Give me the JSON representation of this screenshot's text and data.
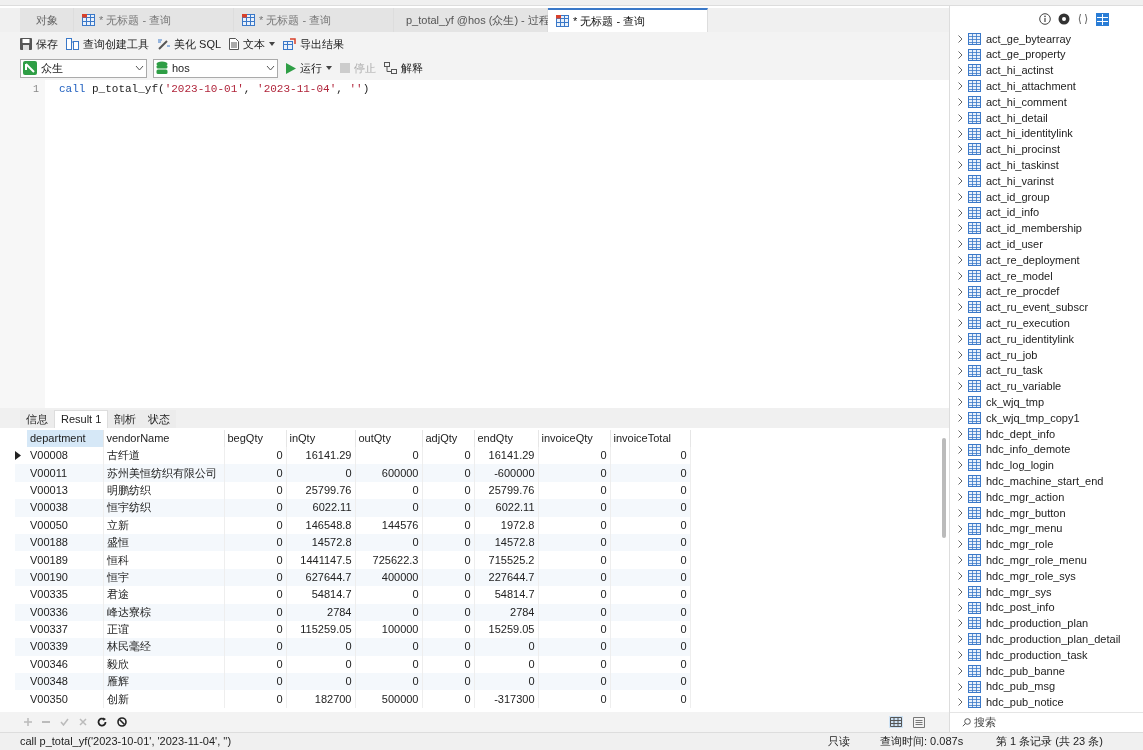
{
  "tabs": [
    {
      "label": "对象",
      "kind": "objects",
      "selected": false
    },
    {
      "label": "* 无标题 - 查询",
      "kind": "query",
      "selected": false
    },
    {
      "label": "* 无标题 - 查询",
      "kind": "query",
      "selected": false
    },
    {
      "label": "p_total_yf @hos (众生) - 过程",
      "kind": "procedure",
      "selected": false
    },
    {
      "label": "* 无标题 - 查询",
      "kind": "query",
      "selected": true
    }
  ],
  "toolbar": [
    {
      "label": "保存",
      "kind": "save"
    },
    {
      "label": "查询创建工具",
      "kind": "builder"
    },
    {
      "label": "美化 SQL",
      "kind": "beautify"
    },
    {
      "label": "文本",
      "kind": "text",
      "dropdown": true
    },
    {
      "label": "导出结果",
      "kind": "export"
    }
  ],
  "connection": "众生",
  "database": "hos",
  "actions": [
    {
      "label": "运行",
      "kind": "run",
      "disabled": false,
      "dropdown": true
    },
    {
      "label": "停止",
      "kind": "stop",
      "disabled": true
    },
    {
      "label": "解释",
      "kind": "explain",
      "disabled": false
    }
  ],
  "editor": {
    "line_number": "1",
    "tokens": [
      {
        "kind": "keyword",
        "text": "call"
      },
      {
        "kind": "plain",
        "text": " p_total_yf("
      },
      {
        "kind": "string",
        "text": "'2023-10-01'"
      },
      {
        "kind": "plain",
        "text": ", "
      },
      {
        "kind": "string",
        "text": "'2023-11-04'"
      },
      {
        "kind": "plain",
        "text": ", "
      },
      {
        "kind": "string",
        "text": "''"
      },
      {
        "kind": "plain",
        "text": ")"
      }
    ]
  },
  "result_tabs": [
    {
      "label": "信息",
      "selected": false
    },
    {
      "label": "Result 1",
      "selected": true
    },
    {
      "label": "剖析",
      "selected": false
    },
    {
      "label": "状态",
      "selected": false
    }
  ],
  "table": {
    "columns": [
      "department",
      "vendorName",
      "begQty",
      "inQty",
      "outQty",
      "adjQty",
      "endQty",
      "invoiceQty",
      "invoiceTotal"
    ],
    "rows": [
      {
        "selected": true,
        "cells": [
          "V00008",
          "古纤道",
          "0",
          "16141.29",
          "0",
          "0",
          "16141.29",
          "0",
          "0"
        ]
      },
      {
        "selected": false,
        "cells": [
          "V00011",
          "苏州美恒纺织有限公司",
          "0",
          "0",
          "600000",
          "0",
          "-600000",
          "0",
          "0"
        ]
      },
      {
        "selected": false,
        "cells": [
          "V00013",
          "明鹏纺织",
          "0",
          "25799.76",
          "0",
          "0",
          "25799.76",
          "0",
          "0"
        ]
      },
      {
        "selected": false,
        "cells": [
          "V00038",
          "恒宇纺织",
          "0",
          "6022.11",
          "0",
          "0",
          "6022.11",
          "0",
          "0"
        ]
      },
      {
        "selected": false,
        "cells": [
          "V00050",
          "立新",
          "0",
          "146548.8",
          "144576",
          "0",
          "1972.8",
          "0",
          "0"
        ]
      },
      {
        "selected": false,
        "cells": [
          "V00188",
          "盛恒",
          "0",
          "14572.8",
          "0",
          "0",
          "14572.8",
          "0",
          "0"
        ]
      },
      {
        "selected": false,
        "cells": [
          "V00189",
          "恒科",
          "0",
          "1441147.5",
          "725622.3",
          "0",
          "715525.2",
          "0",
          "0"
        ]
      },
      {
        "selected": false,
        "cells": [
          "V00190",
          "恒宇",
          "0",
          "627644.7",
          "400000",
          "0",
          "227644.7",
          "0",
          "0"
        ]
      },
      {
        "selected": false,
        "cells": [
          "V00335",
          "君途",
          "0",
          "54814.7",
          "0",
          "0",
          "54814.7",
          "0",
          "0"
        ]
      },
      {
        "selected": false,
        "cells": [
          "V00336",
          "峰达寮棕",
          "0",
          "2784",
          "0",
          "0",
          "2784",
          "0",
          "0"
        ]
      },
      {
        "selected": false,
        "cells": [
          "V00337",
          "正谊",
          "0",
          "115259.05",
          "100000",
          "0",
          "15259.05",
          "0",
          "0"
        ]
      },
      {
        "selected": false,
        "cells": [
          "V00339",
          "林民毫经",
          "0",
          "0",
          "0",
          "0",
          "0",
          "0",
          "0"
        ]
      },
      {
        "selected": false,
        "cells": [
          "V00346",
          "毅欣",
          "0",
          "0",
          "0",
          "0",
          "0",
          "0",
          "0"
        ]
      },
      {
        "selected": false,
        "cells": [
          "V00348",
          "雁辉",
          "0",
          "0",
          "0",
          "0",
          "0",
          "0",
          "0"
        ]
      },
      {
        "selected": false,
        "cells": [
          "V00350",
          "创新",
          "0",
          "182700",
          "500000",
          "0",
          "-317300",
          "0",
          "0"
        ]
      }
    ]
  },
  "status_bar": {
    "sql": "call p_total_yf('2023-10-01', '2023-11-04', '')",
    "mode": "只读",
    "query_time": "查询时间: 0.087s",
    "record": "第 1 条记录 (共 23 条)"
  },
  "object_panel": {
    "tables": [
      "act_ge_bytearray",
      "act_ge_property",
      "act_hi_actinst",
      "act_hi_attachment",
      "act_hi_comment",
      "act_hi_detail",
      "act_hi_identitylink",
      "act_hi_procinst",
      "act_hi_taskinst",
      "act_hi_varinst",
      "act_id_group",
      "act_id_info",
      "act_id_membership",
      "act_id_user",
      "act_re_deployment",
      "act_re_model",
      "act_re_procdef",
      "act_ru_event_subscr",
      "act_ru_execution",
      "act_ru_identitylink",
      "act_ru_job",
      "act_ru_task",
      "act_ru_variable",
      "ck_wjq_tmp",
      "ck_wjq_tmp_copy1",
      "hdc_dept_info",
      "hdc_info_demote",
      "hdc_log_login",
      "hdc_machine_start_end",
      "hdc_mgr_action",
      "hdc_mgr_button",
      "hdc_mgr_menu",
      "hdc_mgr_role",
      "hdc_mgr_role_menu",
      "hdc_mgr_role_sys",
      "hdc_mgr_sys",
      "hdc_post_info",
      "hdc_production_plan",
      "hdc_production_plan_detail",
      "hdc_production_task",
      "hdc_pub_banne",
      "hdc_pub_msg",
      "hdc_pub_notice"
    ],
    "search_placeholder": "搜索"
  }
}
